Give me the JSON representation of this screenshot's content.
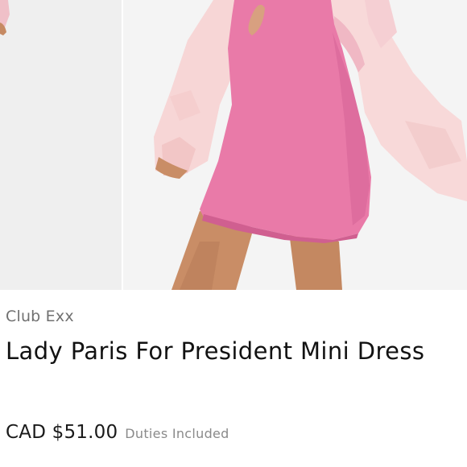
{
  "product": {
    "brand": "Club Exx",
    "title": "Lady Paris For President Mini Dress",
    "price": "CAD $51.00",
    "duties_note": "Duties Included"
  },
  "gallery": {
    "colors": {
      "dress": "#e879a6",
      "jacket": "#f7d3d3",
      "skin": "#c68a63",
      "background": "#f2f2f2"
    }
  }
}
